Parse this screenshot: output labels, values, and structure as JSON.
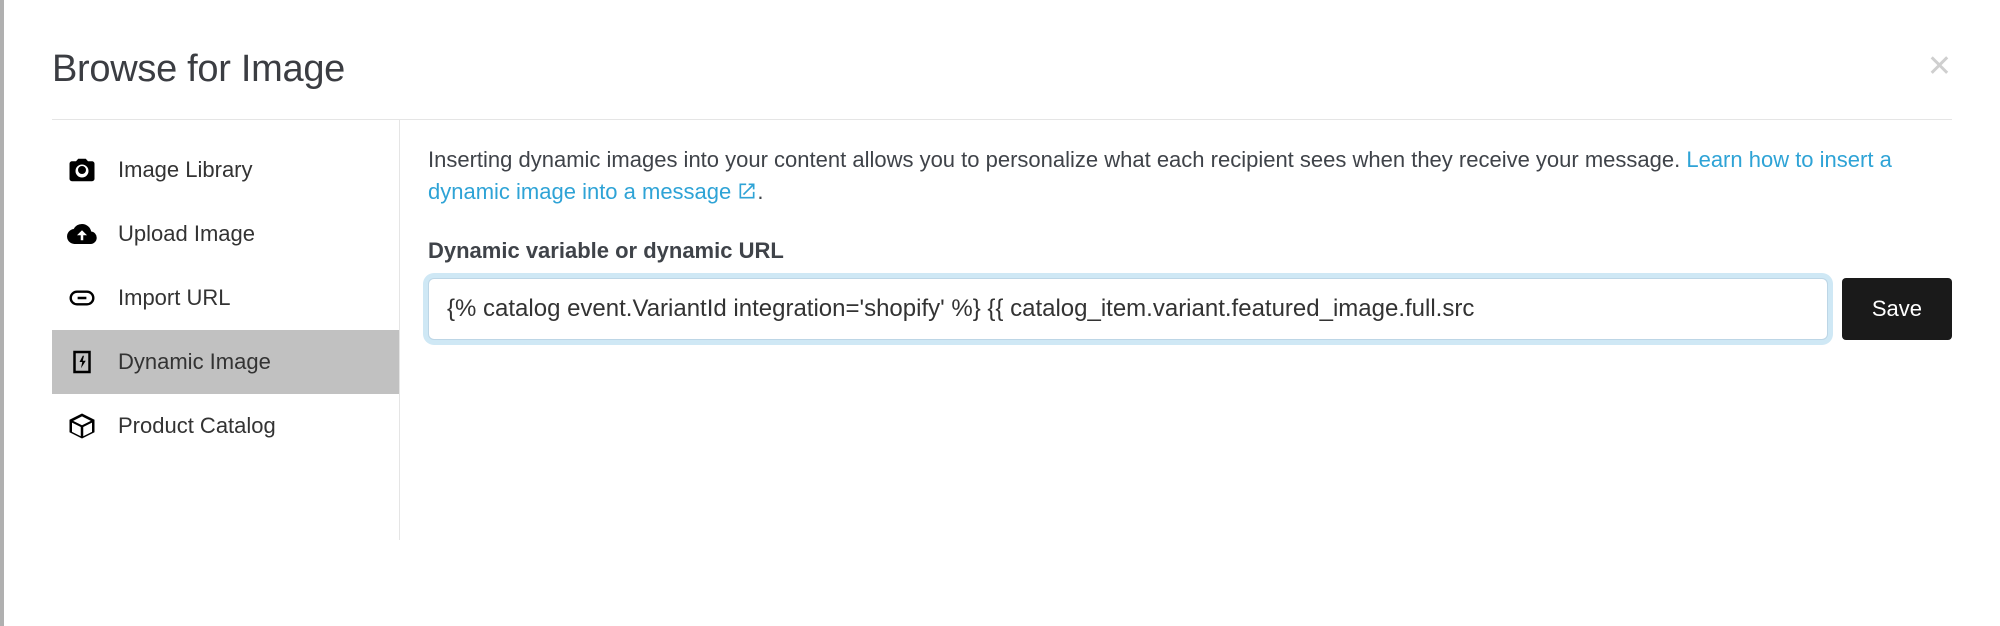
{
  "modal": {
    "title": "Browse for Image"
  },
  "sidebar": {
    "items": [
      {
        "label": "Image Library"
      },
      {
        "label": "Upload Image"
      },
      {
        "label": "Import URL"
      },
      {
        "label": "Dynamic Image"
      },
      {
        "label": "Product Catalog"
      }
    ]
  },
  "content": {
    "description_pre": "Inserting dynamic images into your content allows you to personalize what each recipient sees when they receive your message. ",
    "description_link": "Learn how to insert a dynamic image into a message",
    "description_post": ".",
    "field_label": "Dynamic variable or dynamic URL",
    "input_value": "{% catalog event.VariantId integration='shopify' %} {{ catalog_item.variant.featured_image.full.src",
    "save_label": "Save"
  }
}
